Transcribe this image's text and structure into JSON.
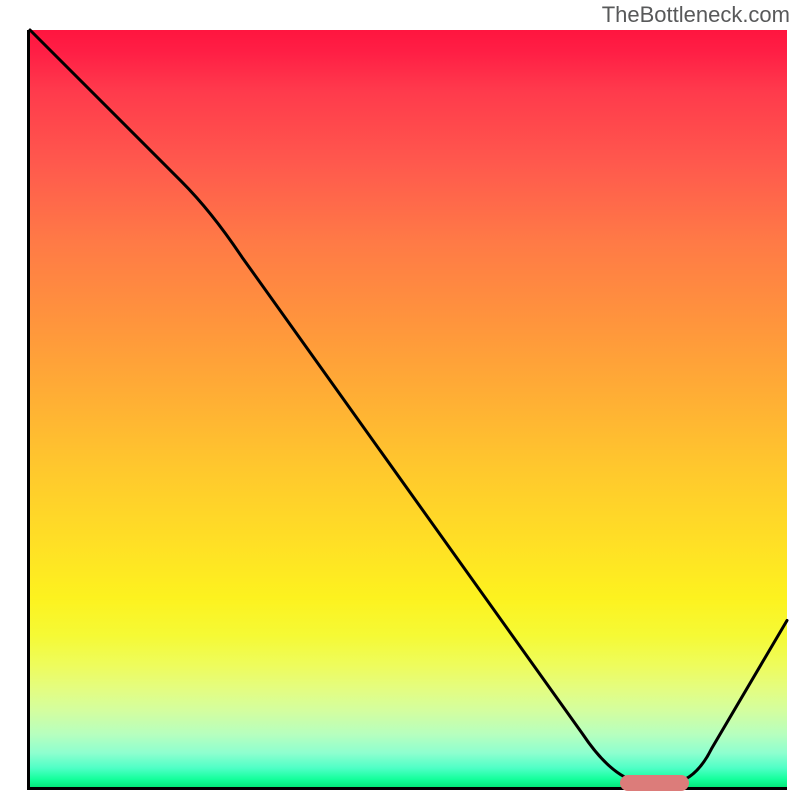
{
  "watermark": "TheBottleneck.com",
  "chart_data": {
    "type": "line",
    "title": "",
    "xlabel": "",
    "ylabel": "",
    "ylim": [
      0,
      100
    ],
    "xlim": [
      0,
      100
    ],
    "series": [
      {
        "name": "curve",
        "x": [
          0,
          22,
          78,
          86,
          100
        ],
        "values": [
          100,
          78,
          2,
          0,
          22
        ]
      }
    ],
    "marker": {
      "x_start": 78,
      "x_end": 87,
      "y": 0
    },
    "background": "rainbow-gradient-vertical"
  },
  "colors": {
    "curve": "#000000",
    "marker": "#dc7c7a",
    "axis": "#000000"
  }
}
